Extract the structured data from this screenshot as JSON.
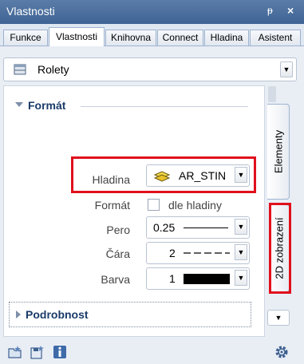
{
  "window": {
    "title": "Vlastnosti",
    "pin_glyph": "ᵽ",
    "close_glyph": "×"
  },
  "tabs": [
    {
      "label": "Funkce"
    },
    {
      "label": "Vlastnosti"
    },
    {
      "label": "Knihovna"
    },
    {
      "label": "Connect"
    },
    {
      "label": "Hladina"
    },
    {
      "label": "Asistent"
    }
  ],
  "object_selector": {
    "value": "Rolety",
    "icon": "window-icon"
  },
  "format_section": {
    "title": "Formát",
    "fields": {
      "hladina": {
        "label": "Hladina",
        "value": "AR_STIN",
        "icon": "layer-icon"
      },
      "format": {
        "label": "Formát",
        "checkbox_label": "dle hladiny",
        "checked": false
      },
      "pero": {
        "label": "Pero",
        "value": "0.25"
      },
      "cara": {
        "label": "Čára",
        "value": "2"
      },
      "barva": {
        "label": "Barva",
        "value": "1",
        "swatch_color": "#000000"
      }
    }
  },
  "detail_section": {
    "title": "Podrobnost"
  },
  "side_tabs": [
    {
      "label": "Elementy"
    },
    {
      "label": "2D zobrazení"
    }
  ],
  "toolbar": {
    "icons": [
      "open-favorites-icon",
      "save-favorites-icon",
      "info-icon",
      "settings-icon"
    ]
  },
  "colors": {
    "highlight": "#e0101c",
    "titlebar": "#4a6fa0",
    "section_title": "#1a3a6a"
  }
}
